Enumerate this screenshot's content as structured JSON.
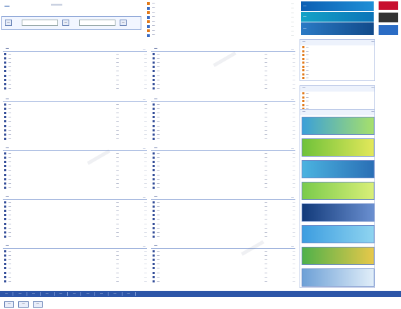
{
  "header": {
    "logo_small": "—",
    "logo_big": "—",
    "search_buttons": [
      "—",
      "—",
      "—"
    ],
    "colors": {
      "accent": "#2d56a8",
      "border": "#9fb3dd",
      "link": "#1a2c6b"
    }
  },
  "top_news": [
    {
      "text": "—",
      "date": "—"
    },
    {
      "text": "—",
      "date": "—"
    },
    {
      "text": "—",
      "date": "—"
    },
    {
      "text": "—",
      "date": "—"
    },
    {
      "text": "—",
      "date": "—"
    },
    {
      "text": "—",
      "date": "—"
    },
    {
      "text": "—",
      "date": "—"
    },
    {
      "text": "—",
      "date": "—"
    }
  ],
  "sections_left": [
    {
      "title": "—",
      "more": "—",
      "rows": [
        "—",
        "—",
        "—",
        "—",
        "—",
        "—",
        "—",
        "—",
        "—"
      ]
    },
    {
      "title": "—",
      "more": "—",
      "rows": [
        "—",
        "—",
        "—",
        "—",
        "—",
        "—",
        "—",
        "—",
        "—"
      ]
    },
    {
      "title": "—",
      "more": "—",
      "rows": [
        "—",
        "—",
        "—",
        "—",
        "—",
        "—",
        "—",
        "—",
        "—"
      ]
    },
    {
      "title": "—",
      "more": "—",
      "rows": [
        "—",
        "—",
        "—",
        "—",
        "—",
        "—",
        "—",
        "—",
        "—"
      ]
    },
    {
      "title": "—",
      "more": "—",
      "rows": [
        "—",
        "—",
        "—",
        "—",
        "—",
        "—",
        "—",
        "—"
      ]
    }
  ],
  "sections_mid": [
    {
      "title": "—",
      "more": "—",
      "rows": [
        "—",
        "—",
        "—",
        "—",
        "—",
        "—",
        "—",
        "—",
        "—"
      ]
    },
    {
      "title": "—",
      "more": "—",
      "rows": [
        "—",
        "—",
        "—",
        "—",
        "—",
        "—",
        "—",
        "—",
        "—"
      ]
    },
    {
      "title": "—",
      "more": "—",
      "rows": [
        "—",
        "—",
        "—",
        "—",
        "—",
        "—",
        "—",
        "—",
        "—"
      ]
    },
    {
      "title": "—",
      "more": "—",
      "rows": [
        "—",
        "—",
        "—",
        "—",
        "—",
        "—",
        "—",
        "—",
        "—"
      ]
    },
    {
      "title": "—",
      "more": "—",
      "rows": [
        "—",
        "—",
        "—",
        "—",
        "—",
        "—",
        "—",
        "—"
      ]
    }
  ],
  "row_tag": "—",
  "row_date": "—",
  "right": {
    "ads": [
      "—",
      "—",
      "—"
    ],
    "boxes": [
      {
        "title": "—",
        "more": "—",
        "rows": [
          "—",
          "—",
          "—",
          "—",
          "—",
          "—",
          "—",
          "—",
          "—"
        ]
      },
      {
        "title": "—",
        "more": "—",
        "rows": [
          "—",
          "—",
          "—",
          "—",
          "—"
        ]
      },
      {
        "title": "—",
        "more": "—",
        "rows": [
          "—",
          "—",
          "—",
          "—",
          "—",
          "—",
          "—",
          "—",
          "—",
          "—",
          "—",
          "—"
        ]
      }
    ]
  },
  "bottom_nav": [
    "—",
    "—",
    "—",
    "—",
    "—",
    "—",
    "—",
    "—",
    "—",
    "—"
  ],
  "footer_buttons": [
    "—",
    "—",
    "—"
  ],
  "watermark": "—"
}
